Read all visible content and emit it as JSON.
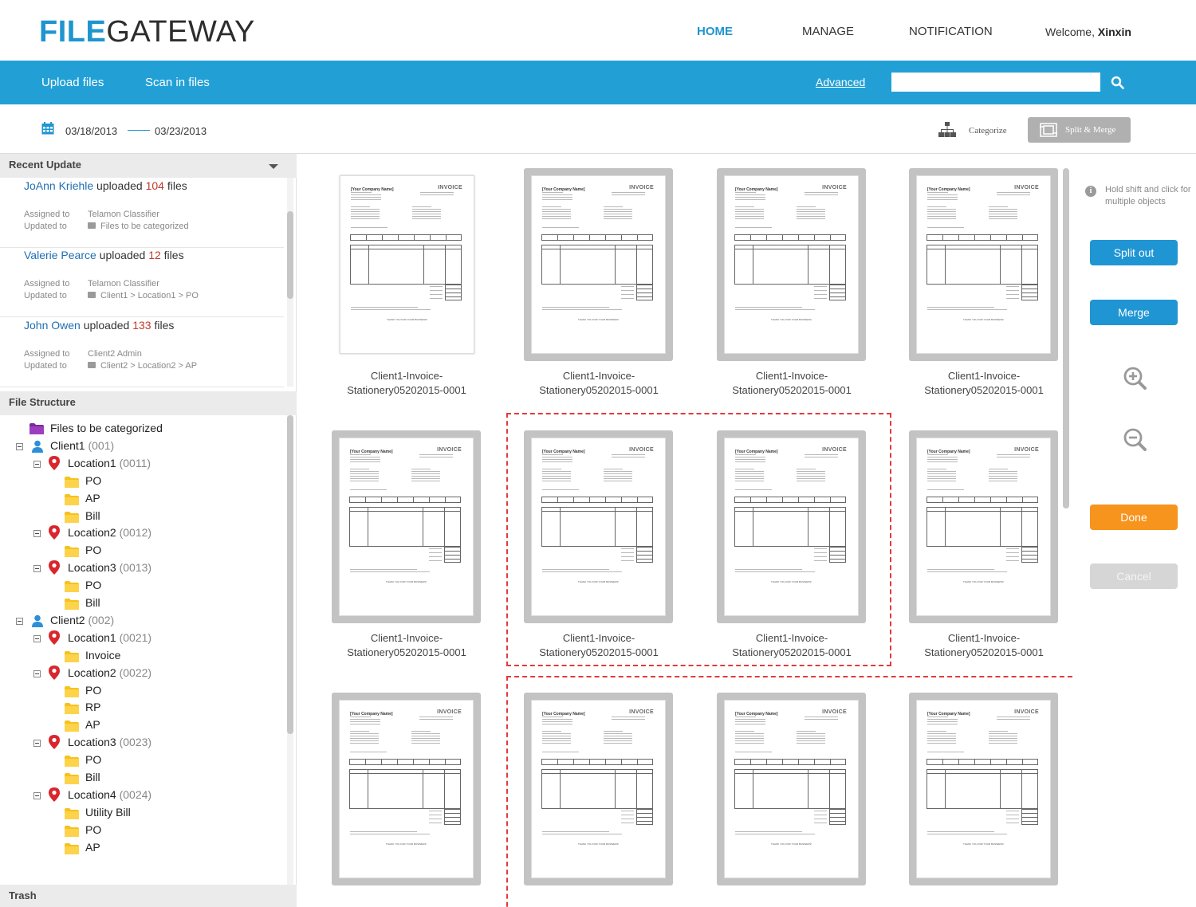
{
  "app": {
    "logo_part1": "FILE",
    "logo_part2": "GATEWAY"
  },
  "nav": {
    "home": "HOME",
    "manage": "MANAGE",
    "notification": "NOTIFICATION",
    "welcome_prefix": "Welcome, ",
    "user": "Xinxin"
  },
  "toolbar": {
    "upload": "Upload files",
    "scan": "Scan in files",
    "advanced": "Advanced",
    "search_value": "",
    "accent": "#22a0d6"
  },
  "daterange": {
    "from": "03/18/2013",
    "to": "03/23/2013"
  },
  "actions": {
    "categorize": "Categorize",
    "split_merge": "Split & Merge"
  },
  "sidebar": {
    "recent_title": "Recent Update",
    "assigned_label": "Assigned to",
    "updated_label": "Updated to",
    "updates": [
      {
        "user": "JoAnn Kriehle",
        "verb": " uploaded ",
        "count": "104",
        "unit": " files",
        "assigned": "Telamon Classifier",
        "updated": "Files to be categorized"
      },
      {
        "user": "Valerie Pearce",
        "verb": " uploaded ",
        "count": "12",
        "unit": " files",
        "assigned": "Telamon Classifier",
        "updated": "Client1 > Location1 > PO"
      },
      {
        "user": "John Owen",
        "verb": " uploaded ",
        "count": "133",
        "unit": " files",
        "assigned": "Client2 Admin",
        "updated": "Client2 > Location2 > AP"
      }
    ],
    "structure_title": "File Structure",
    "trash_title": "Trash",
    "tree": [
      {
        "type": "root",
        "level": 0,
        "label": "Files to be categorized",
        "count": ""
      },
      {
        "type": "client",
        "level": 0,
        "label": "Client1",
        "count": " (001)"
      },
      {
        "type": "location",
        "level": 1,
        "label": "Location1",
        "count": " (0011)"
      },
      {
        "type": "folder",
        "level": 2,
        "label": "PO",
        "count": ""
      },
      {
        "type": "folder",
        "level": 2,
        "label": "AP",
        "count": ""
      },
      {
        "type": "folder",
        "level": 2,
        "label": "Bill",
        "count": ""
      },
      {
        "type": "location",
        "level": 1,
        "label": "Location2",
        "count": " (0012)"
      },
      {
        "type": "folder",
        "level": 2,
        "label": "PO",
        "count": ""
      },
      {
        "type": "location",
        "level": 1,
        "label": "Location3",
        "count": " (0013)"
      },
      {
        "type": "folder",
        "level": 2,
        "label": "PO",
        "count": ""
      },
      {
        "type": "folder",
        "level": 2,
        "label": "Bill",
        "count": ""
      },
      {
        "type": "client",
        "level": 0,
        "label": "Client2",
        "count": " (002)"
      },
      {
        "type": "location",
        "level": 1,
        "label": "Location1",
        "count": " (0021)"
      },
      {
        "type": "folder",
        "level": 2,
        "label": "Invoice",
        "count": ""
      },
      {
        "type": "location",
        "level": 1,
        "label": "Location2",
        "count": " (0022)"
      },
      {
        "type": "folder",
        "level": 2,
        "label": "PO",
        "count": ""
      },
      {
        "type": "folder",
        "level": 2,
        "label": "RP",
        "count": ""
      },
      {
        "type": "folder",
        "level": 2,
        "label": "AP",
        "count": ""
      },
      {
        "type": "location",
        "level": 1,
        "label": "Location3",
        "count": " (0023)"
      },
      {
        "type": "folder",
        "level": 2,
        "label": "PO",
        "count": ""
      },
      {
        "type": "folder",
        "level": 2,
        "label": "Bill",
        "count": ""
      },
      {
        "type": "location",
        "level": 1,
        "label": "Location4",
        "count": " (0024)"
      },
      {
        "type": "folder",
        "level": 2,
        "label": "Utility Bill",
        "count": ""
      },
      {
        "type": "folder",
        "level": 2,
        "label": "PO",
        "count": ""
      },
      {
        "type": "folder",
        "level": 2,
        "label": "AP",
        "count": ""
      }
    ]
  },
  "documents": {
    "doc_title": "INVOICE",
    "company": "[Your Company Name]",
    "thanks": "THANK YOU FOR YOUR BUSINESS!",
    "items": [
      {
        "name_line1": "Client1-Invoice-",
        "name_line2": "Stationery05202015-0001",
        "framed": false
      },
      {
        "name_line1": "Client1-Invoice-",
        "name_line2": "Stationery05202015-0001",
        "framed": true
      },
      {
        "name_line1": "Client1-Invoice-",
        "name_line2": "Stationery05202015-0001",
        "framed": true
      },
      {
        "name_line1": "Client1-Invoice-",
        "name_line2": "Stationery05202015-0001",
        "framed": true
      },
      {
        "name_line1": "Client1-Invoice-",
        "name_line2": "Stationery05202015-0001",
        "framed": true
      },
      {
        "name_line1": "Client1-Invoice-",
        "name_line2": "Stationery05202015-0001",
        "framed": true
      },
      {
        "name_line1": "Client1-Invoice-",
        "name_line2": "Stationery05202015-0001",
        "framed": true
      },
      {
        "name_line1": "Client1-Invoice-",
        "name_line2": "Stationery05202015-0001",
        "framed": true
      },
      {
        "name_line1": "",
        "name_line2": "",
        "framed": true
      },
      {
        "name_line1": "",
        "name_line2": "",
        "framed": true
      },
      {
        "name_line1": "",
        "name_line2": "",
        "framed": true
      },
      {
        "name_line1": "",
        "name_line2": "",
        "framed": true
      }
    ]
  },
  "panel": {
    "hint": "Hold shift and click for multiple objects",
    "split_out": "Split out",
    "merge": "Merge",
    "done": "Done",
    "cancel": "Cancel"
  }
}
